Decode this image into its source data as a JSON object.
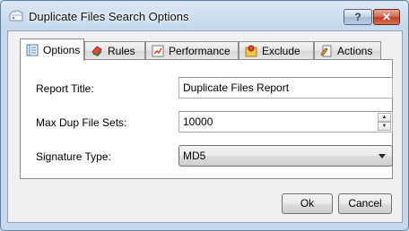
{
  "window": {
    "title": "Duplicate Files Search Options",
    "help_label": "?",
    "close_label": "✕"
  },
  "tabs": [
    {
      "label": "Options",
      "icon": "options-icon",
      "active": true
    },
    {
      "label": "Rules",
      "icon": "rules-icon",
      "active": false
    },
    {
      "label": "Performance",
      "icon": "performance-icon",
      "active": false
    },
    {
      "label": "Exclude",
      "icon": "exclude-icon",
      "active": false
    },
    {
      "label": "Actions",
      "icon": "actions-icon",
      "active": false
    }
  ],
  "form": {
    "report_title_label": "Report Title:",
    "report_title_value": "Duplicate Files Report",
    "max_dup_label": "Max Dup File Sets:",
    "max_dup_value": "10000",
    "signature_label": "Signature Type:",
    "signature_value": "MD5"
  },
  "buttons": {
    "ok": "Ok",
    "cancel": "Cancel"
  }
}
